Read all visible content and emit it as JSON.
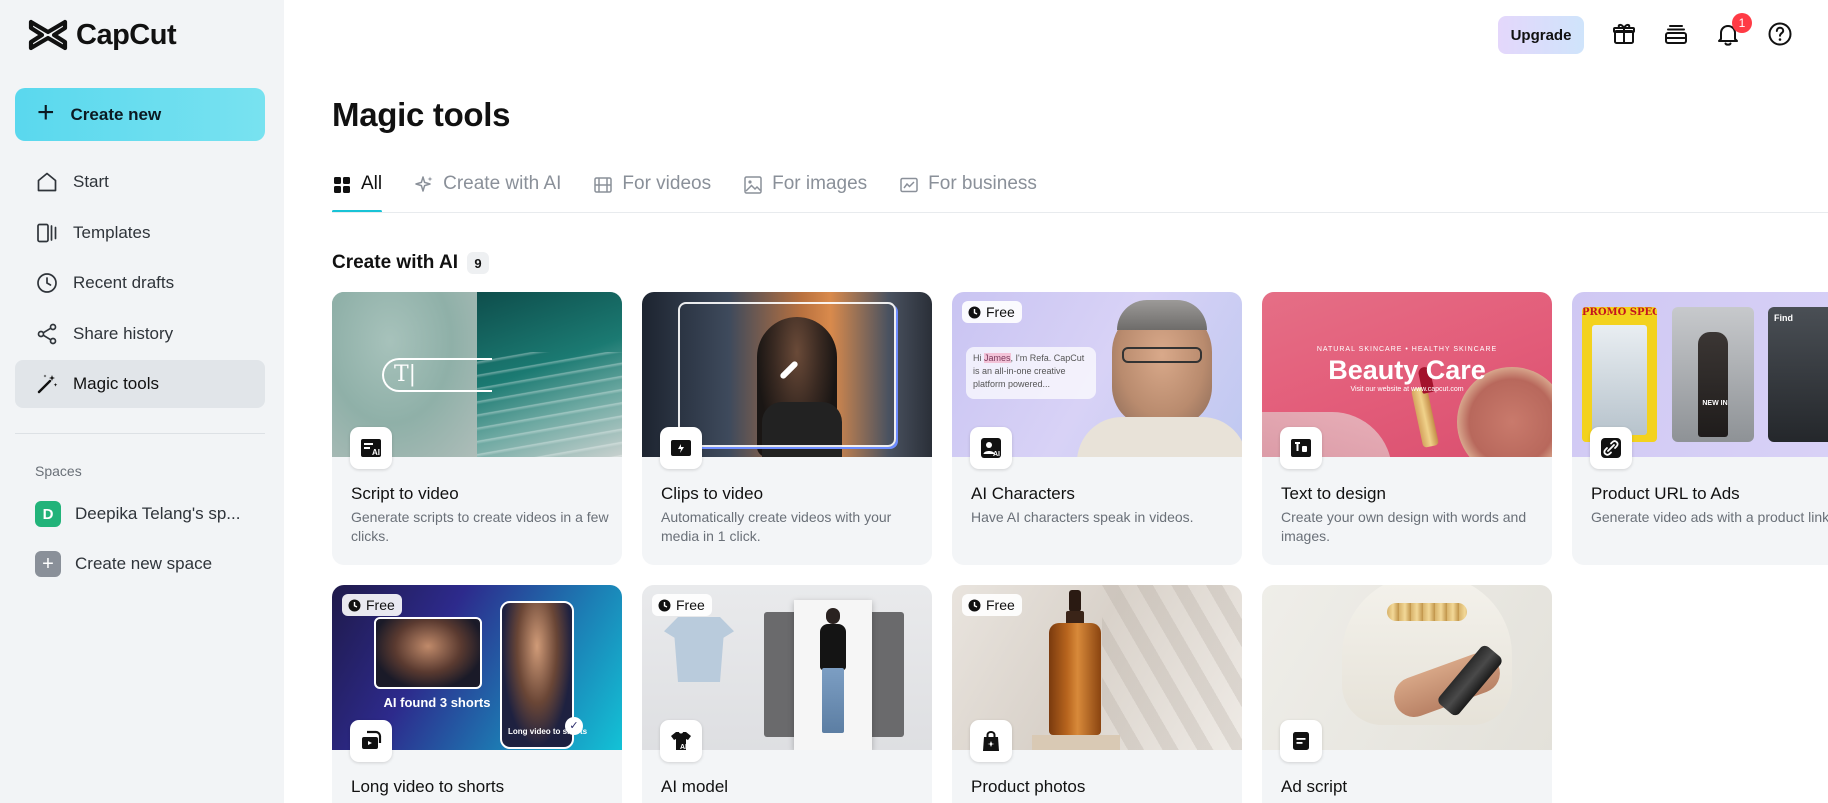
{
  "app": {
    "name": "CapCut",
    "create_new": "Create new"
  },
  "sidebar": {
    "items": [
      {
        "label": "Start",
        "icon": "home-icon"
      },
      {
        "label": "Templates",
        "icon": "templates-icon"
      },
      {
        "label": "Recent drafts",
        "icon": "clock-icon"
      },
      {
        "label": "Share history",
        "icon": "share-icon"
      },
      {
        "label": "Magic tools",
        "icon": "magic-wand-icon",
        "active": true
      }
    ],
    "spaces_label": "Spaces",
    "space_name": "Deepika Telang's sp...",
    "space_initial": "D",
    "create_space": "Create new space"
  },
  "topbar": {
    "upgrade": "Upgrade",
    "notification_count": "1"
  },
  "page": {
    "title": "Magic tools",
    "tabs": [
      {
        "label": "All",
        "icon": "grid-icon",
        "active": true
      },
      {
        "label": "Create with AI",
        "icon": "sparkle-icon"
      },
      {
        "label": "For videos",
        "icon": "film-icon"
      },
      {
        "label": "For images",
        "icon": "image-icon"
      },
      {
        "label": "For business",
        "icon": "business-icon"
      }
    ],
    "section_title": "Create with AI",
    "section_count": "9"
  },
  "cards": [
    {
      "title": "Script to video",
      "desc": "Generate scripts to create videos in a few clicks.",
      "free": ""
    },
    {
      "title": "Clips to video",
      "desc": "Automatically create videos with your media in 1 click.",
      "free": ""
    },
    {
      "title": "AI Characters",
      "desc": "Have AI characters speak in videos.",
      "free": "Free"
    },
    {
      "title": "Text to design",
      "desc": "Create your own design with words and images.",
      "free": ""
    },
    {
      "title": "Product URL to Ads",
      "desc": "Generate video ads with a product link.",
      "free": ""
    },
    {
      "title": "Long video to shorts",
      "desc": "",
      "free": "Free"
    },
    {
      "title": "AI model",
      "desc": "",
      "free": "Free"
    },
    {
      "title": "Product photos",
      "desc": "",
      "free": "Free"
    },
    {
      "title": "Ad script",
      "desc": "",
      "free": ""
    }
  ],
  "thumb_text": {
    "ai_characters_bubble_1": "Hi ",
    "ai_characters_bubble_name": "James",
    "ai_characters_bubble_2": ", I'm Refa. CapCut is an all-in-one creative platform powered...",
    "beauty_care_tag": "NATURAL SKINCARE • HEALTHY SKINCARE",
    "beauty_care": "Beauty Care",
    "beauty_care_sub": "Visit our website at www.capcut.com",
    "promo": "PROMO SPECIAL",
    "new_in": "NEW IN",
    "find": "Find",
    "shorts_found": "AI found 3 shorts",
    "long_to_shorts": "Long video to shorts"
  },
  "colors": {
    "accent": "#19c3d6",
    "create_btn": "#5ad8ee",
    "sidebar_bg": "#f2f4f6",
    "badge": "#ff3b45"
  }
}
